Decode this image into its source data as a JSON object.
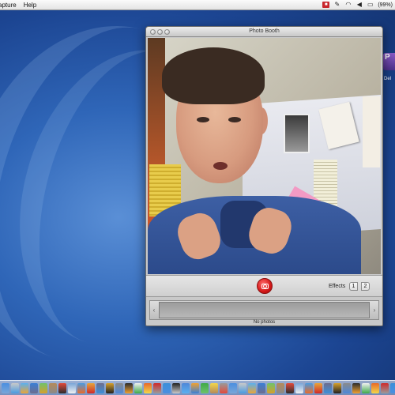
{
  "menubar": {
    "menus": [
      "apture",
      "Help"
    ],
    "battery_text": "(99%)"
  },
  "window": {
    "title": "Photo Booth",
    "effects_label": "Effects",
    "effects_page_1": "1",
    "effects_page_2": "2",
    "status": "No photos"
  },
  "colors": {
    "shutter": "#d41818",
    "desktop_blue": "#2f66b8"
  },
  "dock": {
    "icons": [
      "finder-icon",
      "dashboard-icon",
      "mail-icon",
      "safari-icon",
      "ichat-icon",
      "address-book-icon",
      "ical-icon",
      "preview-icon",
      "itunes-icon",
      "iphoto-icon",
      "imovie-icon",
      "garageband-icon",
      "system-preferences-icon",
      "terminal-icon",
      "textedit-icon",
      "firefox-icon",
      "photo-booth-icon",
      "quicktime-icon",
      "dvd-player-icon",
      "keynote-icon",
      "pages-icon",
      "numbers-icon",
      "stickies-icon",
      "calculator-icon",
      "chess-icon",
      "font-book-icon",
      "image-capture-icon",
      "network-icon",
      "activity-monitor-icon",
      "grapher-icon",
      "app-store-icon",
      "camino-icon",
      "skype-icon",
      "vlc-icon",
      "word-icon",
      "excel-icon",
      "powerpoint-icon",
      "entourage-icon",
      "acrobat-icon",
      "photoshop-icon",
      "illustrator-icon",
      "dreamweaver-icon",
      "flash-icon",
      "downloads-icon",
      "trash-icon"
    ]
  }
}
